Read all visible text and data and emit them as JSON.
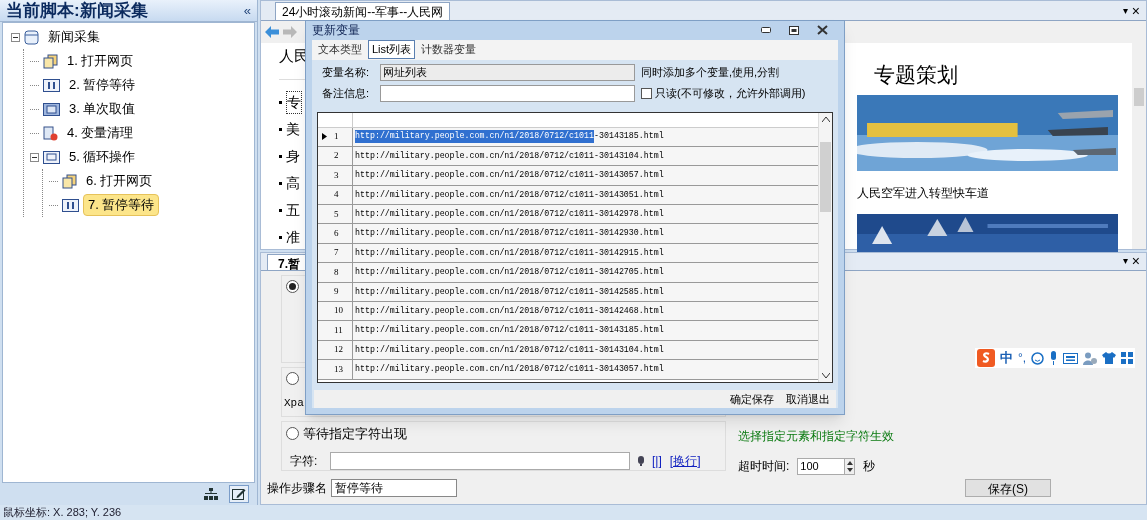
{
  "sidebar": {
    "title": "当前脚本:新闻采集",
    "collapse": "«",
    "tree": [
      {
        "label": "新闻采集",
        "kind": "script",
        "expanded": true,
        "selected": false,
        "children": [
          {
            "label": "1. 打开网页",
            "kind": "page",
            "selected": false
          },
          {
            "label": "2. 暂停等待",
            "kind": "pause",
            "selected": false
          },
          {
            "label": "3. 单次取值",
            "kind": "value",
            "selected": false
          },
          {
            "label": "4. 变量清理",
            "kind": "clear",
            "selected": false
          },
          {
            "label": "5. 循环操作",
            "kind": "loop",
            "expanded": true,
            "selected": false,
            "children": [
              {
                "label": "6. 打开网页",
                "kind": "page",
                "selected": false
              },
              {
                "label": "7. 暂停等待",
                "kind": "pause",
                "selected": true
              }
            ]
          }
        ]
      }
    ],
    "tools": [
      {
        "kind": "hierarchy",
        "selected": false
      },
      {
        "kind": "edit",
        "selected": true
      }
    ]
  },
  "browser": {
    "tab": "24小时滚动新闻--军事--人民网",
    "menu": "▾",
    "close": "×",
    "site_text": "人民",
    "bullets": [
      "专",
      "美",
      "身",
      "高",
      "五",
      "准"
    ],
    "feature": {
      "heading": "专题策划",
      "caption": "人民空军进入转型快车道"
    }
  },
  "step_panel": {
    "tab": "7.暂",
    "menu": "▾",
    "close": "×",
    "radios": [
      {
        "selected": true
      },
      {
        "selected": false
      },
      {
        "label": "等待指定字符出现",
        "selected": false
      }
    ],
    "xpath_label": "Xpa",
    "char_label": "字符:",
    "links": [
      "[|]",
      "[换行]"
    ],
    "hint": "选择指定元素和指定字符生效",
    "timeout_label": "超时时间:",
    "timeout": "100",
    "unit": "秒",
    "step_name_label": "操作步骤名",
    "step_name": "暂停等待",
    "save": "保存(S)"
  },
  "ime": {
    "mode": "中",
    "punct": "°,"
  },
  "dialog": {
    "title": "更新变量",
    "tabs": [
      {
        "label": "文本类型",
        "selected": false
      },
      {
        "label": "List列表",
        "selected": true
      },
      {
        "label": "计数器变量",
        "selected": false
      }
    ],
    "name_label": "变量名称:",
    "name": "网址列表",
    "name_hint": "同时添加多个变量,使用,分割",
    "note_label": "备注信息:",
    "readonly": {
      "label": "只读(不可修改，允许外部调用)",
      "checked": false
    },
    "rows": [
      {
        "num": "1",
        "url_highlighted": "http://military.people.com.cn/n1/2018/0712/c1011",
        "url": "-30143185.html",
        "current": true
      },
      {
        "num": "2",
        "url": "http://military.people.com.cn/n1/2018/0712/c1011-30143104.html",
        "current": false
      },
      {
        "num": "3",
        "url": "http://military.people.com.cn/n1/2018/0712/c1011-30143057.html",
        "current": false
      },
      {
        "num": "4",
        "url": "http://military.people.com.cn/n1/2018/0712/c1011-30143051.html",
        "current": false
      },
      {
        "num": "5",
        "url": "http://military.people.com.cn/n1/2018/0712/c1011-30142978.html",
        "current": false
      },
      {
        "num": "6",
        "url": "http://military.people.com.cn/n1/2018/0712/c1011-30142930.html",
        "current": false
      },
      {
        "num": "7",
        "url": "http://military.people.com.cn/n1/2018/0712/c1011-30142915.html",
        "current": false
      },
      {
        "num": "8",
        "url": "http://military.people.com.cn/n1/2018/0712/c1011-30142705.html",
        "current": false
      },
      {
        "num": "9",
        "url": "http://military.people.com.cn/n1/2018/0712/c1011-30142585.html",
        "current": false
      },
      {
        "num": "10",
        "url": "http://military.people.com.cn/n1/2018/0712/c1011-30142468.html",
        "current": false
      },
      {
        "num": "11",
        "url": "http://military.people.com.cn/n1/2018/0712/c1011-30143185.html",
        "current": false
      },
      {
        "num": "12",
        "url": "http://military.people.com.cn/n1/2018/0712/c1011-30143104.html",
        "current": false
      },
      {
        "num": "13",
        "url": "http://military.people.com.cn/n1/2018/0712/c1011-30143057.html",
        "current": false
      }
    ],
    "buttons": [
      "确定保存",
      "取消退出"
    ]
  },
  "status_bar": "鼠标坐标: X. 283; Y. 236"
}
